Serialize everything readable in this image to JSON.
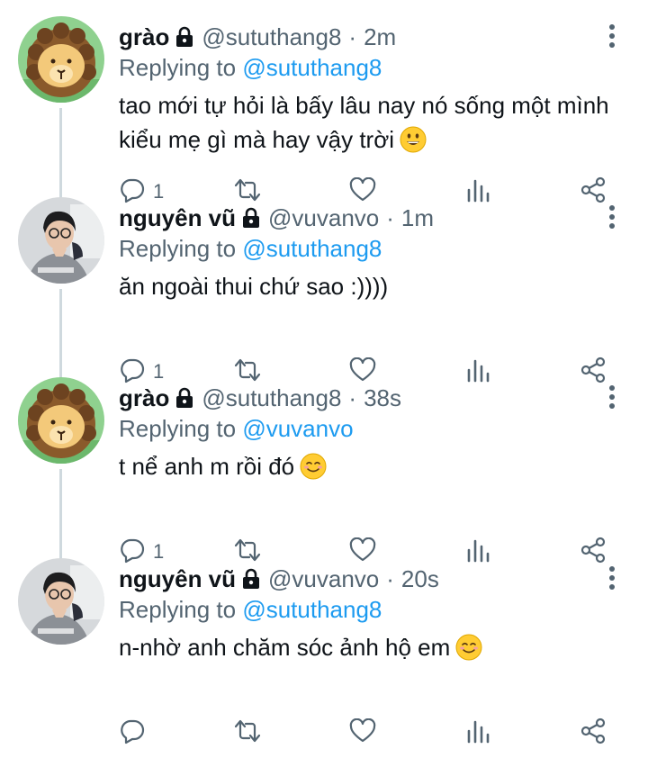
{
  "tweets": [
    {
      "name": "grào",
      "handle": "@sututhang8",
      "separator": "·",
      "time": "2m",
      "replying_prefix": "Replying to",
      "replying_to": "@sututhang8",
      "text_line1": "tao mới tự hỏi là bấy lâu nay nó sống một mình",
      "text_line2": "kiểu mẹ gì mà hay vậy trời",
      "emoji": "grinning-face",
      "reply_count": "1",
      "avatar": "lion-cartoon"
    },
    {
      "name": "nguyên vũ",
      "handle": "@vuvanvo",
      "separator": "·",
      "time": "1m",
      "replying_prefix": "Replying to",
      "replying_to": "@sututhang8",
      "text_line1": "ăn ngoài thui chứ sao :))))",
      "reply_count": "1",
      "avatar": "person-photo"
    },
    {
      "name": "grào",
      "handle": "@sututhang8",
      "separator": "·",
      "time": "38s",
      "replying_prefix": "Replying to",
      "replying_to": "@vuvanvo",
      "text_line1": "t nể anh m rồi đó",
      "emoji": "smiling-face",
      "reply_count": "1",
      "avatar": "lion-cartoon"
    },
    {
      "name": "nguyên vũ",
      "handle": "@vuvanvo",
      "separator": "·",
      "time": "20s",
      "replying_prefix": "Replying to",
      "replying_to": "@sututhang8",
      "text_line1": "n-nhờ anh chăm sóc ảnh hộ em",
      "emoji": "smiling-face",
      "reply_count": "",
      "avatar": "person-photo"
    }
  ],
  "colors": {
    "accent": "#1d9bf0",
    "secondary_text": "#536471",
    "primary_text": "#0f1419",
    "thread_line": "#cfd9de"
  }
}
